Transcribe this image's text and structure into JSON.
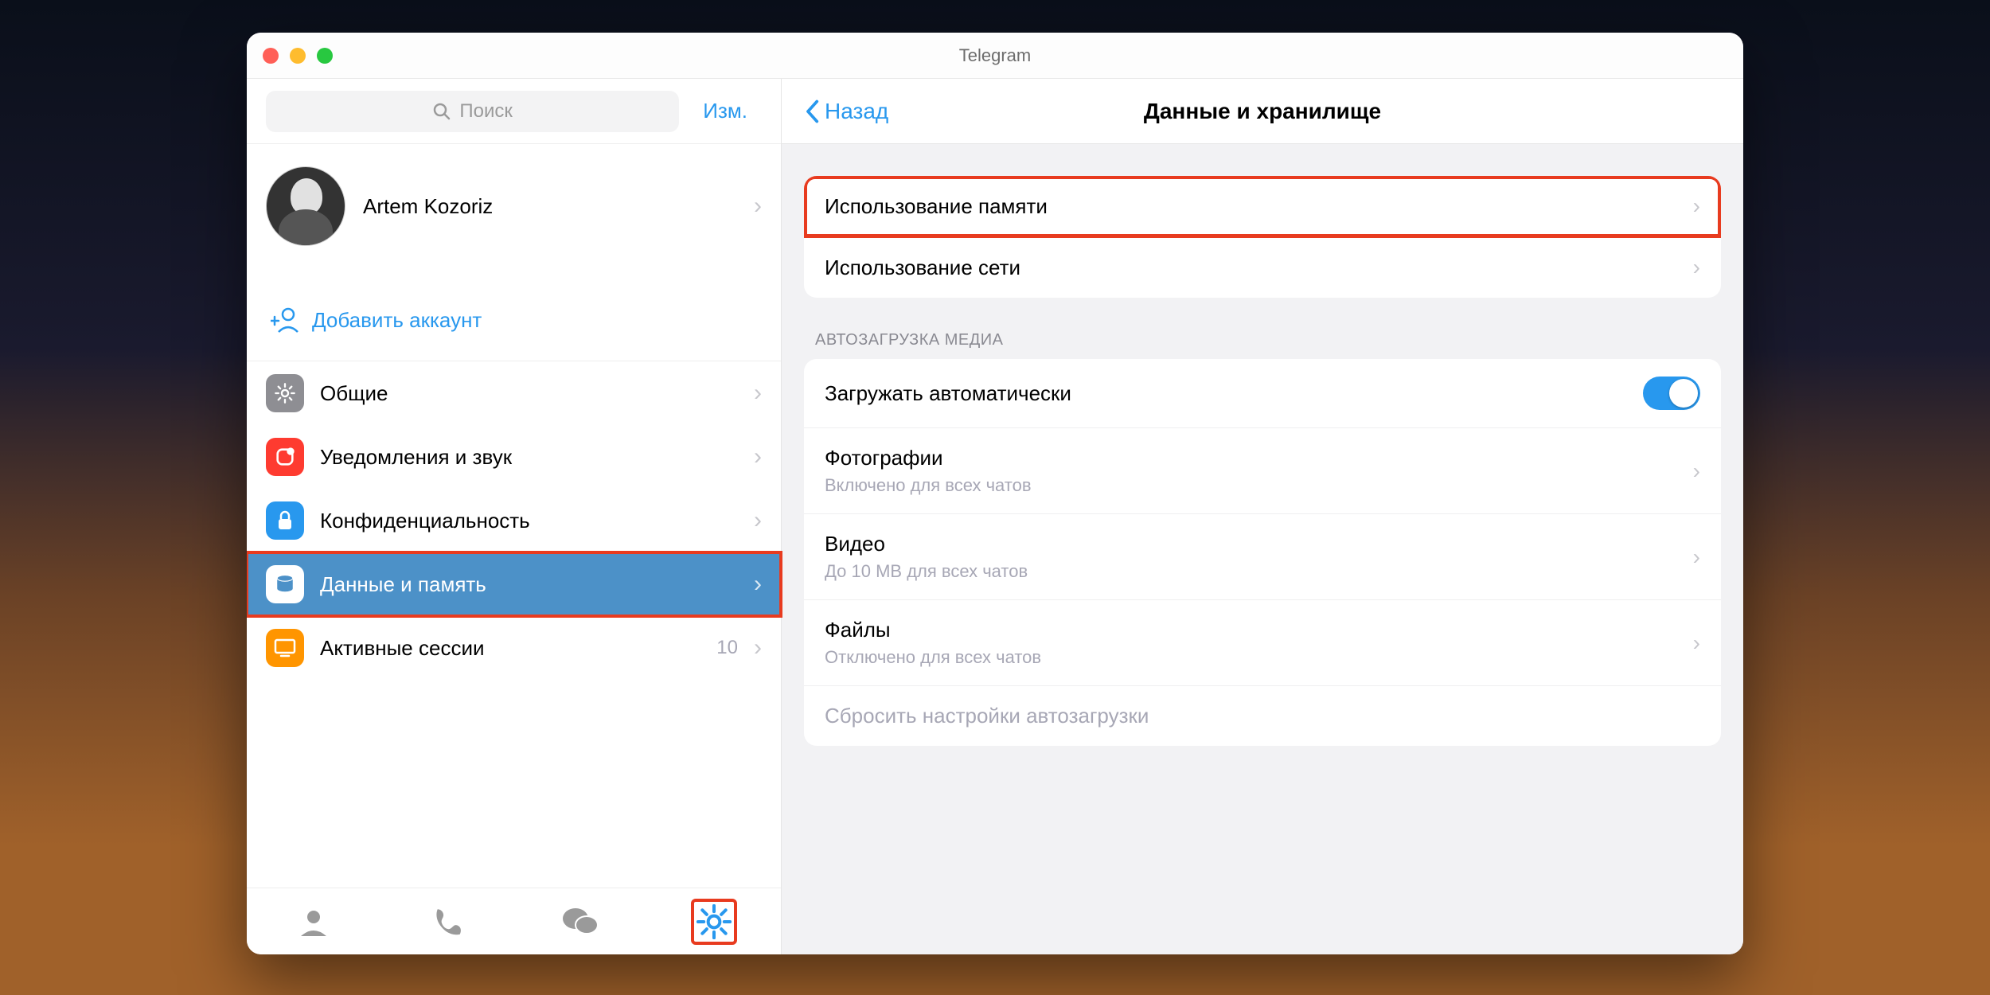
{
  "window": {
    "title": "Telegram"
  },
  "sidebar": {
    "search_placeholder": "Поиск",
    "edit_label": "Изм.",
    "profile_name": "Artem Kozoriz",
    "add_account_label": "Добавить аккаунт",
    "menu": [
      {
        "label": "Общие",
        "color": "#8e8e93",
        "selected": false
      },
      {
        "label": "Уведомления и звук",
        "color": "#fe3b30",
        "selected": false
      },
      {
        "label": "Конфиденциальность",
        "color": "#2898ee",
        "selected": false
      },
      {
        "label": "Данные и память",
        "color": "#4c91c8",
        "selected": true,
        "highlight": true
      },
      {
        "label": "Активные сессии",
        "color": "#ff9500",
        "selected": false,
        "count": "10"
      }
    ]
  },
  "tabs": {
    "items": [
      "contacts",
      "calls",
      "chats",
      "settings"
    ],
    "active": "settings"
  },
  "main": {
    "back_label": "Назад",
    "title": "Данные и хранилище",
    "group1": {
      "row0": {
        "label": "Использование памяти",
        "highlight": true
      },
      "row1": {
        "label": "Использование сети"
      }
    },
    "section_header": "АВТОЗАГРУЗКА МЕДИА",
    "group2": {
      "row0": {
        "title": "Загружать автоматически",
        "toggle_on": true
      },
      "row1": {
        "title": "Фотографии",
        "sub": "Включено для всех чатов"
      },
      "row2": {
        "title": "Видео",
        "sub": "До 10 MB для всех чатов"
      },
      "row3": {
        "title": "Файлы",
        "sub": "Отключено для всех чатов"
      },
      "row4": {
        "title": "Сбросить настройки автозагрузки"
      }
    }
  }
}
